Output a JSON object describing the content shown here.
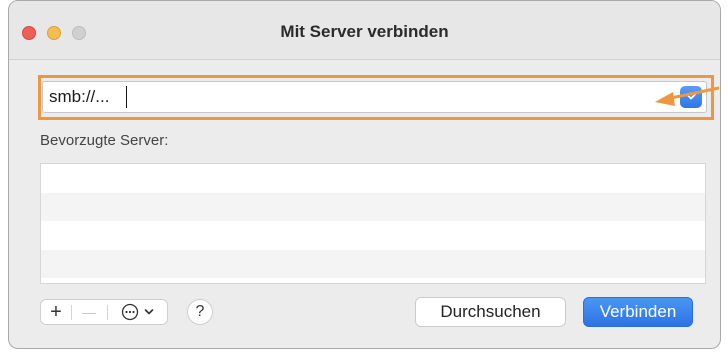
{
  "window": {
    "title": "Mit Server verbinden"
  },
  "url_field": {
    "value": "smb://..."
  },
  "favorites": {
    "label": "Bevorzugte Server:",
    "rows": [
      "",
      "",
      "",
      ""
    ]
  },
  "toolbar": {
    "add_label": "+",
    "remove_label": "—",
    "help_label": "?"
  },
  "buttons": {
    "browse_label": "Durchsuchen",
    "connect_label": "Verbinden"
  },
  "colors": {
    "highlight": "#ef9640",
    "accent": "#2f77e6"
  },
  "icons": [
    "close-icon",
    "minimize-icon",
    "zoom-icon",
    "chevron-down-icon",
    "ellipsis-circle-icon",
    "arrow-left-icon"
  ]
}
